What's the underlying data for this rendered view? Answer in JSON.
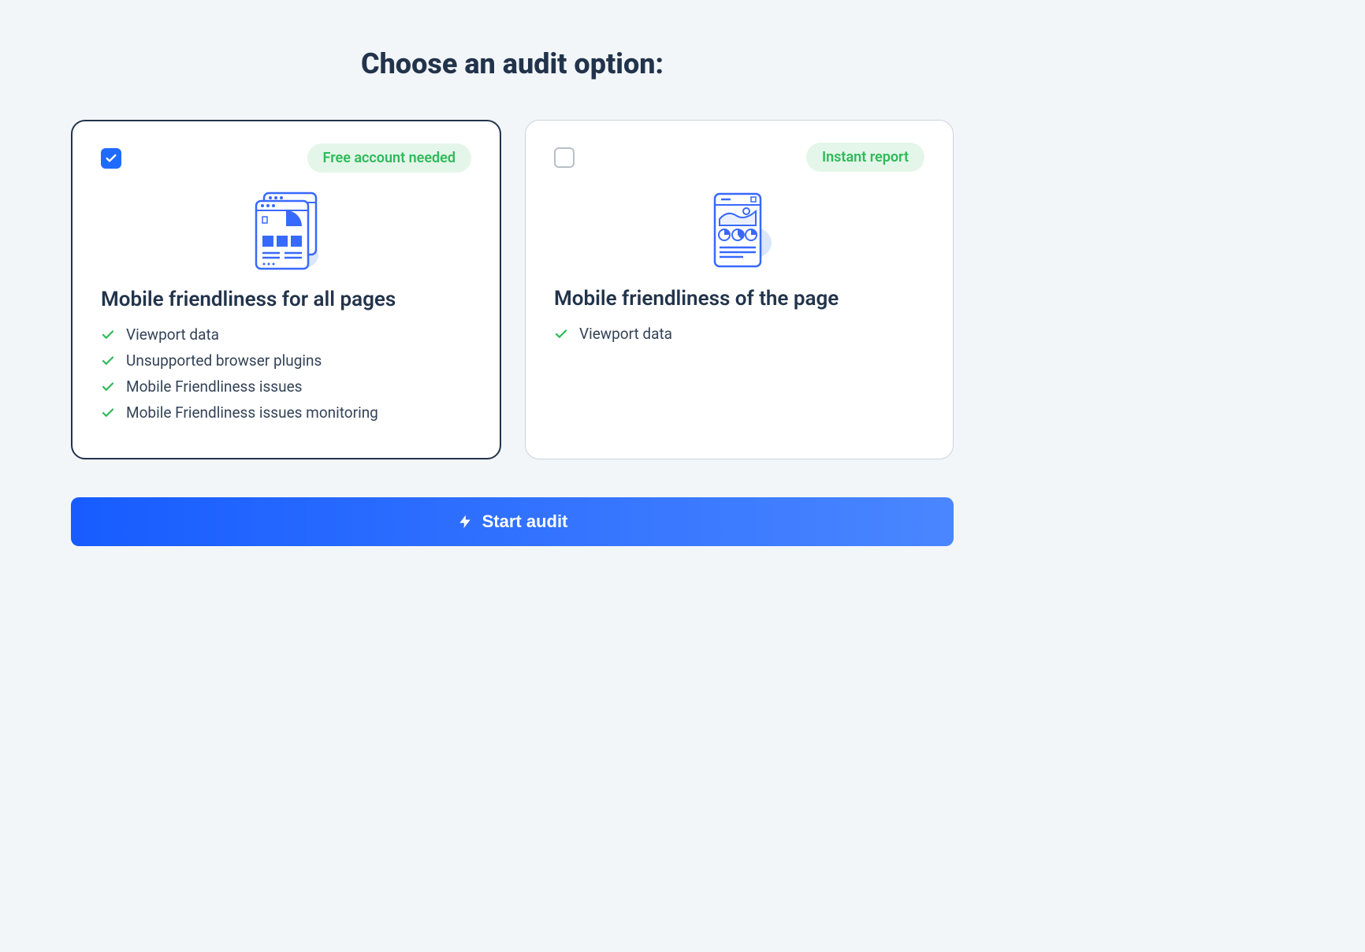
{
  "page_title": "Choose an audit option:",
  "options": {
    "all_pages": {
      "selected": true,
      "badge": "Free account needed",
      "title": "Mobile friendliness for all pages",
      "features": [
        "Viewport data",
        "Unsupported browser plugins",
        "Mobile Friendliness issues",
        "Mobile Friendliness issues monitoring"
      ]
    },
    "single_page": {
      "selected": false,
      "badge": "Instant report",
      "title": "Mobile friendliness of the page",
      "features": [
        "Viewport data"
      ]
    }
  },
  "cta": {
    "label": "Start audit"
  },
  "colors": {
    "accent_blue": "#1f6bff",
    "badge_bg": "#e4f6e9",
    "badge_text": "#2fba5a",
    "dark_text": "#22344b"
  }
}
